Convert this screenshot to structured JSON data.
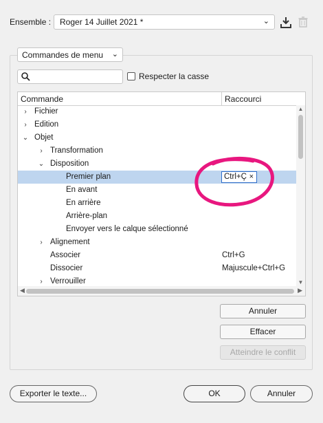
{
  "header": {
    "set_label": "Ensemble :",
    "set_value": "Roger 14 Juillet 2021 *",
    "icons": [
      "chevron-down-icon",
      "download-icon",
      "trash-icon"
    ]
  },
  "filter": {
    "mode_value": "Commandes de menu",
    "search_value": "",
    "case_label": "Respecter la casse",
    "case_checked": false
  },
  "table": {
    "col_command": "Commande",
    "col_shortcut": "Raccourci",
    "rows": [
      {
        "label": "Fichier",
        "shortcut": "",
        "twisty": "›"
      },
      {
        "label": "Edition",
        "shortcut": "",
        "twisty": "›"
      },
      {
        "label": "Objet",
        "shortcut": "",
        "twisty": "⌄"
      },
      {
        "label": "Transformation",
        "shortcut": "",
        "twisty": "›"
      },
      {
        "label": "Disposition",
        "shortcut": "",
        "twisty": "⌄"
      },
      {
        "label": "Premier plan",
        "shortcut": "Ctrl+Ç",
        "editing": true,
        "clear_glyph": "×"
      },
      {
        "label": "En avant",
        "shortcut": ""
      },
      {
        "label": "En arrière",
        "shortcut": ""
      },
      {
        "label": "Arrière-plan",
        "shortcut": ""
      },
      {
        "label": "Envoyer vers le calque sélectionné",
        "shortcut": ""
      },
      {
        "label": "Alignement",
        "shortcut": "",
        "twisty": "›"
      },
      {
        "label": "Associer",
        "shortcut": "Ctrl+G"
      },
      {
        "label": "Dissocier",
        "shortcut": "Majuscule+Ctrl+G"
      },
      {
        "label": "Verrouiller",
        "shortcut": "",
        "twisty": "›"
      }
    ]
  },
  "side_buttons": {
    "undo": "Annuler",
    "clear": "Effacer",
    "goto_conflict": "Atteindre le conflit"
  },
  "footer": {
    "export": "Exporter le texte...",
    "ok": "OK",
    "cancel": "Annuler"
  },
  "colors": {
    "selection": "#bed5ef",
    "annotation": "#e8177f",
    "edit_border": "#2f6dc9"
  }
}
